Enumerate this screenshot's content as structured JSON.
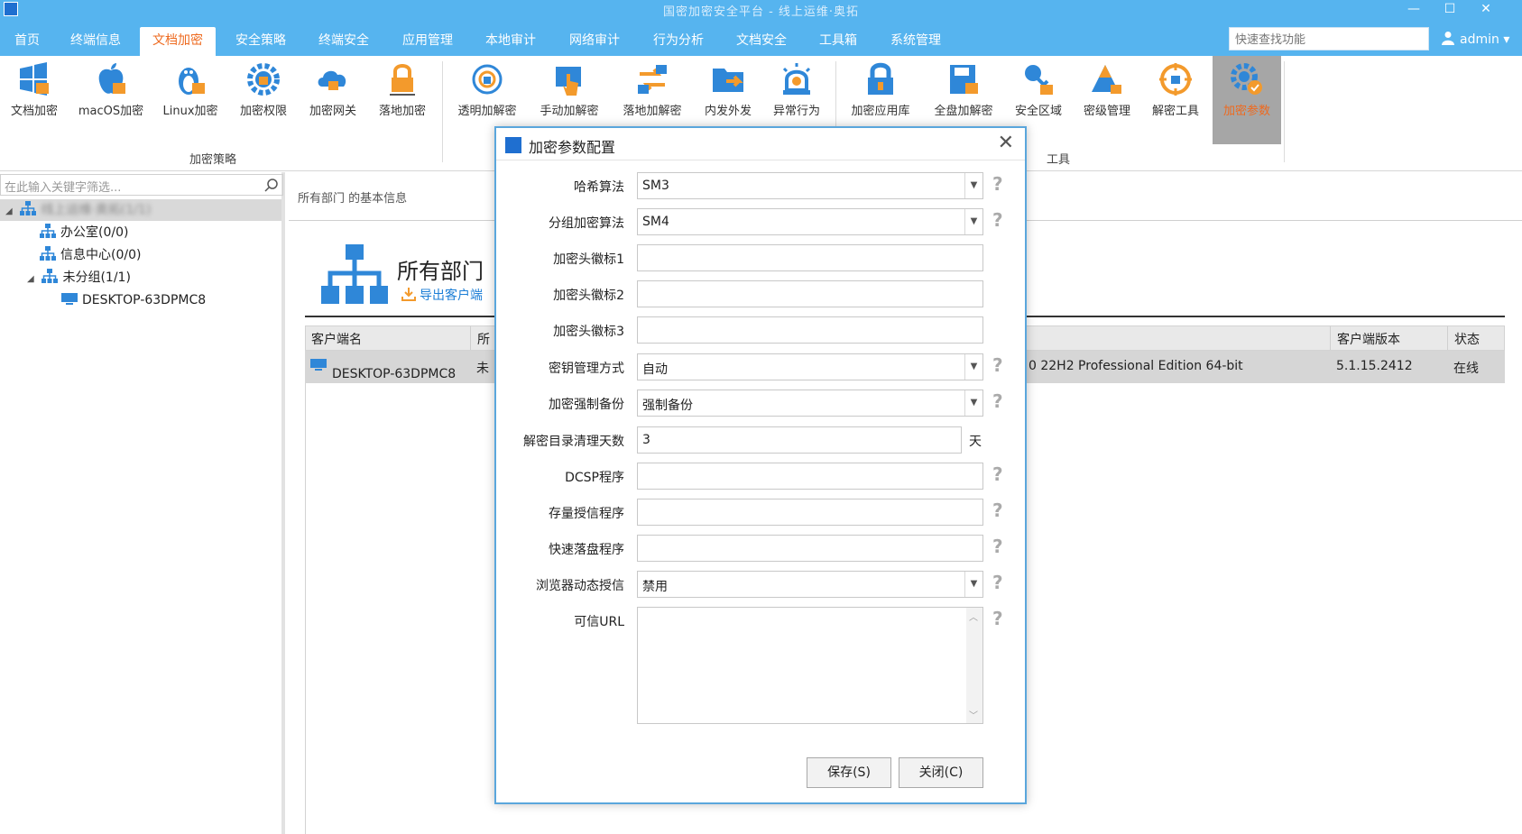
{
  "titlebar": {
    "title": "国密加密安全平台 - 线上运维·奥拓"
  },
  "menu": {
    "items": [
      "首页",
      "终端信息",
      "文档加密",
      "安全策略",
      "终端安全",
      "应用管理",
      "本地审计",
      "网络审计",
      "行为分析",
      "文档安全",
      "工具箱",
      "系统管理"
    ],
    "active_index": 2,
    "quick_search_placeholder": "快速查找功能",
    "user": "admin"
  },
  "ribbon": {
    "buttons": [
      "文档加密",
      "macOS加密",
      "Linux加密",
      "加密权限",
      "加密网关",
      "落地加密",
      "透明加解密",
      "手动加解密",
      "落地加解密",
      "内发外发",
      "异常行为",
      "加密应用库",
      "全盘加解密",
      "安全区域",
      "密级管理",
      "解密工具",
      "加密参数"
    ],
    "active_index": 16,
    "group_encrypt": "加密策略",
    "group_tools": "工具"
  },
  "left_panel": {
    "filter_placeholder": "在此输入关键字筛选...",
    "tree": {
      "root": "线上运维·奥拓(1/1)",
      "office": "办公室(0/0)",
      "info_center": "信息中心(0/0)",
      "ungrouped": "未分组(1/1)",
      "computer": "DESKTOP-63DPMC8"
    }
  },
  "main": {
    "info_label": "所有部门 的基本信息",
    "dept_title": "所有部门",
    "export_label": "导出客户端",
    "columns": {
      "name": "客户端名",
      "group": "所",
      "version": "客户端版本",
      "status": "状态"
    },
    "row": {
      "name": "DESKTOP-63DPMC8",
      "group": "未",
      "os": "0 22H2 Professional Edition 64-bit",
      "version": "5.1.15.2412",
      "status": "在线"
    }
  },
  "dialog": {
    "title": "加密参数配置",
    "fields": {
      "hash_label": "哈希算法",
      "hash_value": "SM3",
      "block_label": "分组加密算法",
      "block_value": "SM4",
      "header1_label": "加密头徽标1",
      "header1_value": "",
      "header2_label": "加密头徽标2",
      "header2_value": "",
      "header3_label": "加密头徽标3",
      "header3_value": "",
      "key_mgmt_label": "密钥管理方式",
      "key_mgmt_value": "自动",
      "backup_label": "加密强制备份",
      "backup_value": "强制备份",
      "cleanup_label": "解密目录清理天数",
      "cleanup_value": "3",
      "cleanup_unit": "天",
      "dcsp_label": "DCSP程序",
      "dcsp_value": "",
      "stock_label": "存量授信程序",
      "stock_value": "",
      "fastdisk_label": "快速落盘程序",
      "fastdisk_value": "",
      "browser_label": "浏览器动态授信",
      "browser_value": "禁用",
      "url_label": "可信URL",
      "url_value": ""
    },
    "save_label": "保存(S)",
    "close_label": "关闭(C)"
  },
  "colors": {
    "accent": "#56b4ef",
    "active_tab": "#ee6a1f",
    "dialog_border": "#5aa6dc"
  }
}
